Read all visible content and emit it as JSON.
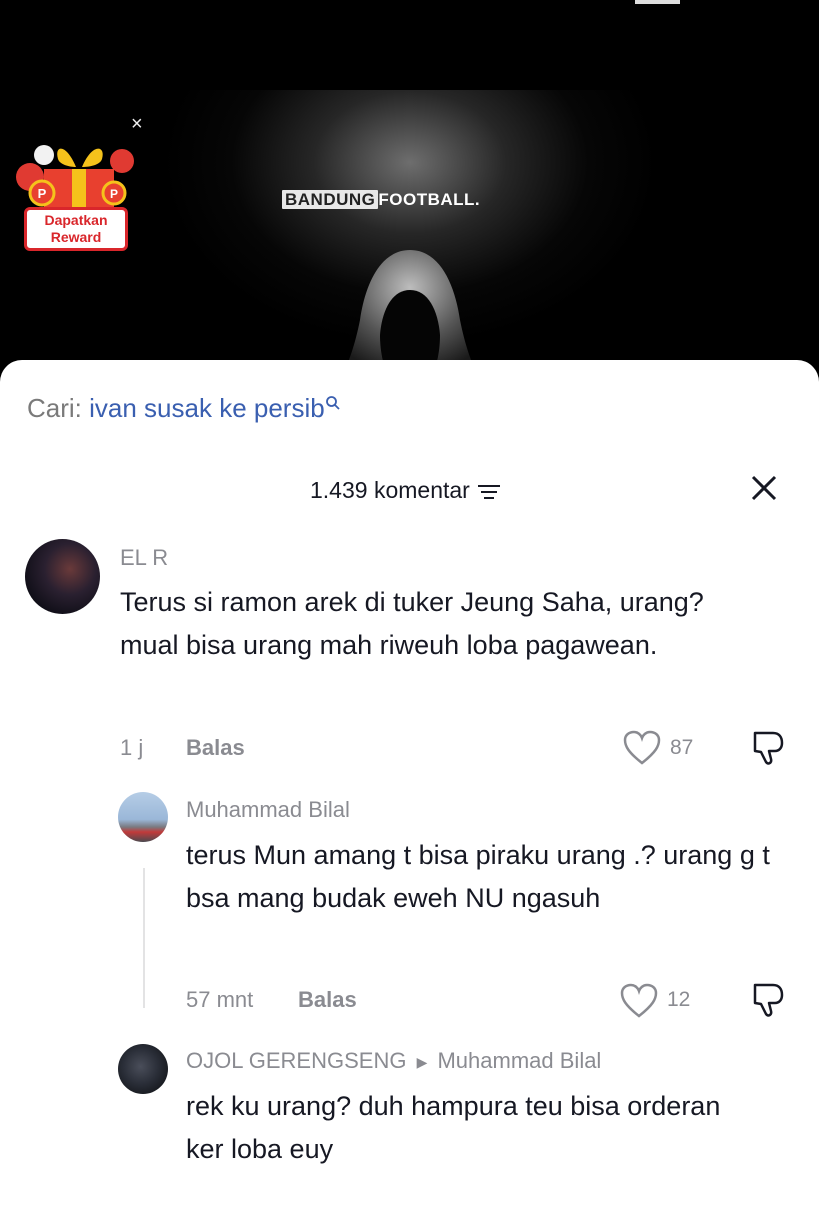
{
  "video": {
    "brand_part1": "BANDUNG",
    "brand_part2": "FOOTBALL."
  },
  "reward": {
    "label_line1": "Dapatkan",
    "label_line2": "Reward",
    "close": "×"
  },
  "search": {
    "prefix": "Cari:",
    "query": "ivan susak ke persib",
    "icon": "search-icon"
  },
  "comments_header": {
    "count_label": "1.439 komentar",
    "filter_icon": "filter-icon",
    "close_icon": "close-icon"
  },
  "comments": [
    {
      "user": "EL R",
      "text": "Terus si ramon arek di tuker Jeung Saha, urang? mual bisa urang mah riweuh loba pagawean.",
      "time": "1 j",
      "reply_label": "Balas",
      "likes": "87"
    },
    {
      "user": "Muhammad Bilal",
      "text": "terus Mun amang t bisa piraku urang .? urang g t bsa mang budak eweh NU ngasuh",
      "time": "57 mnt",
      "reply_label": "Balas",
      "likes": "12"
    },
    {
      "user": "OJOL GERENGSENG",
      "reply_to": "Muhammad Bilal",
      "text": "rek ku urang? duh hampura teu bisa orderan ker loba euy"
    }
  ],
  "colors": {
    "accent_link": "#3a5fb0",
    "reward_red": "#d9262b",
    "muted_text": "#8a8b91"
  }
}
